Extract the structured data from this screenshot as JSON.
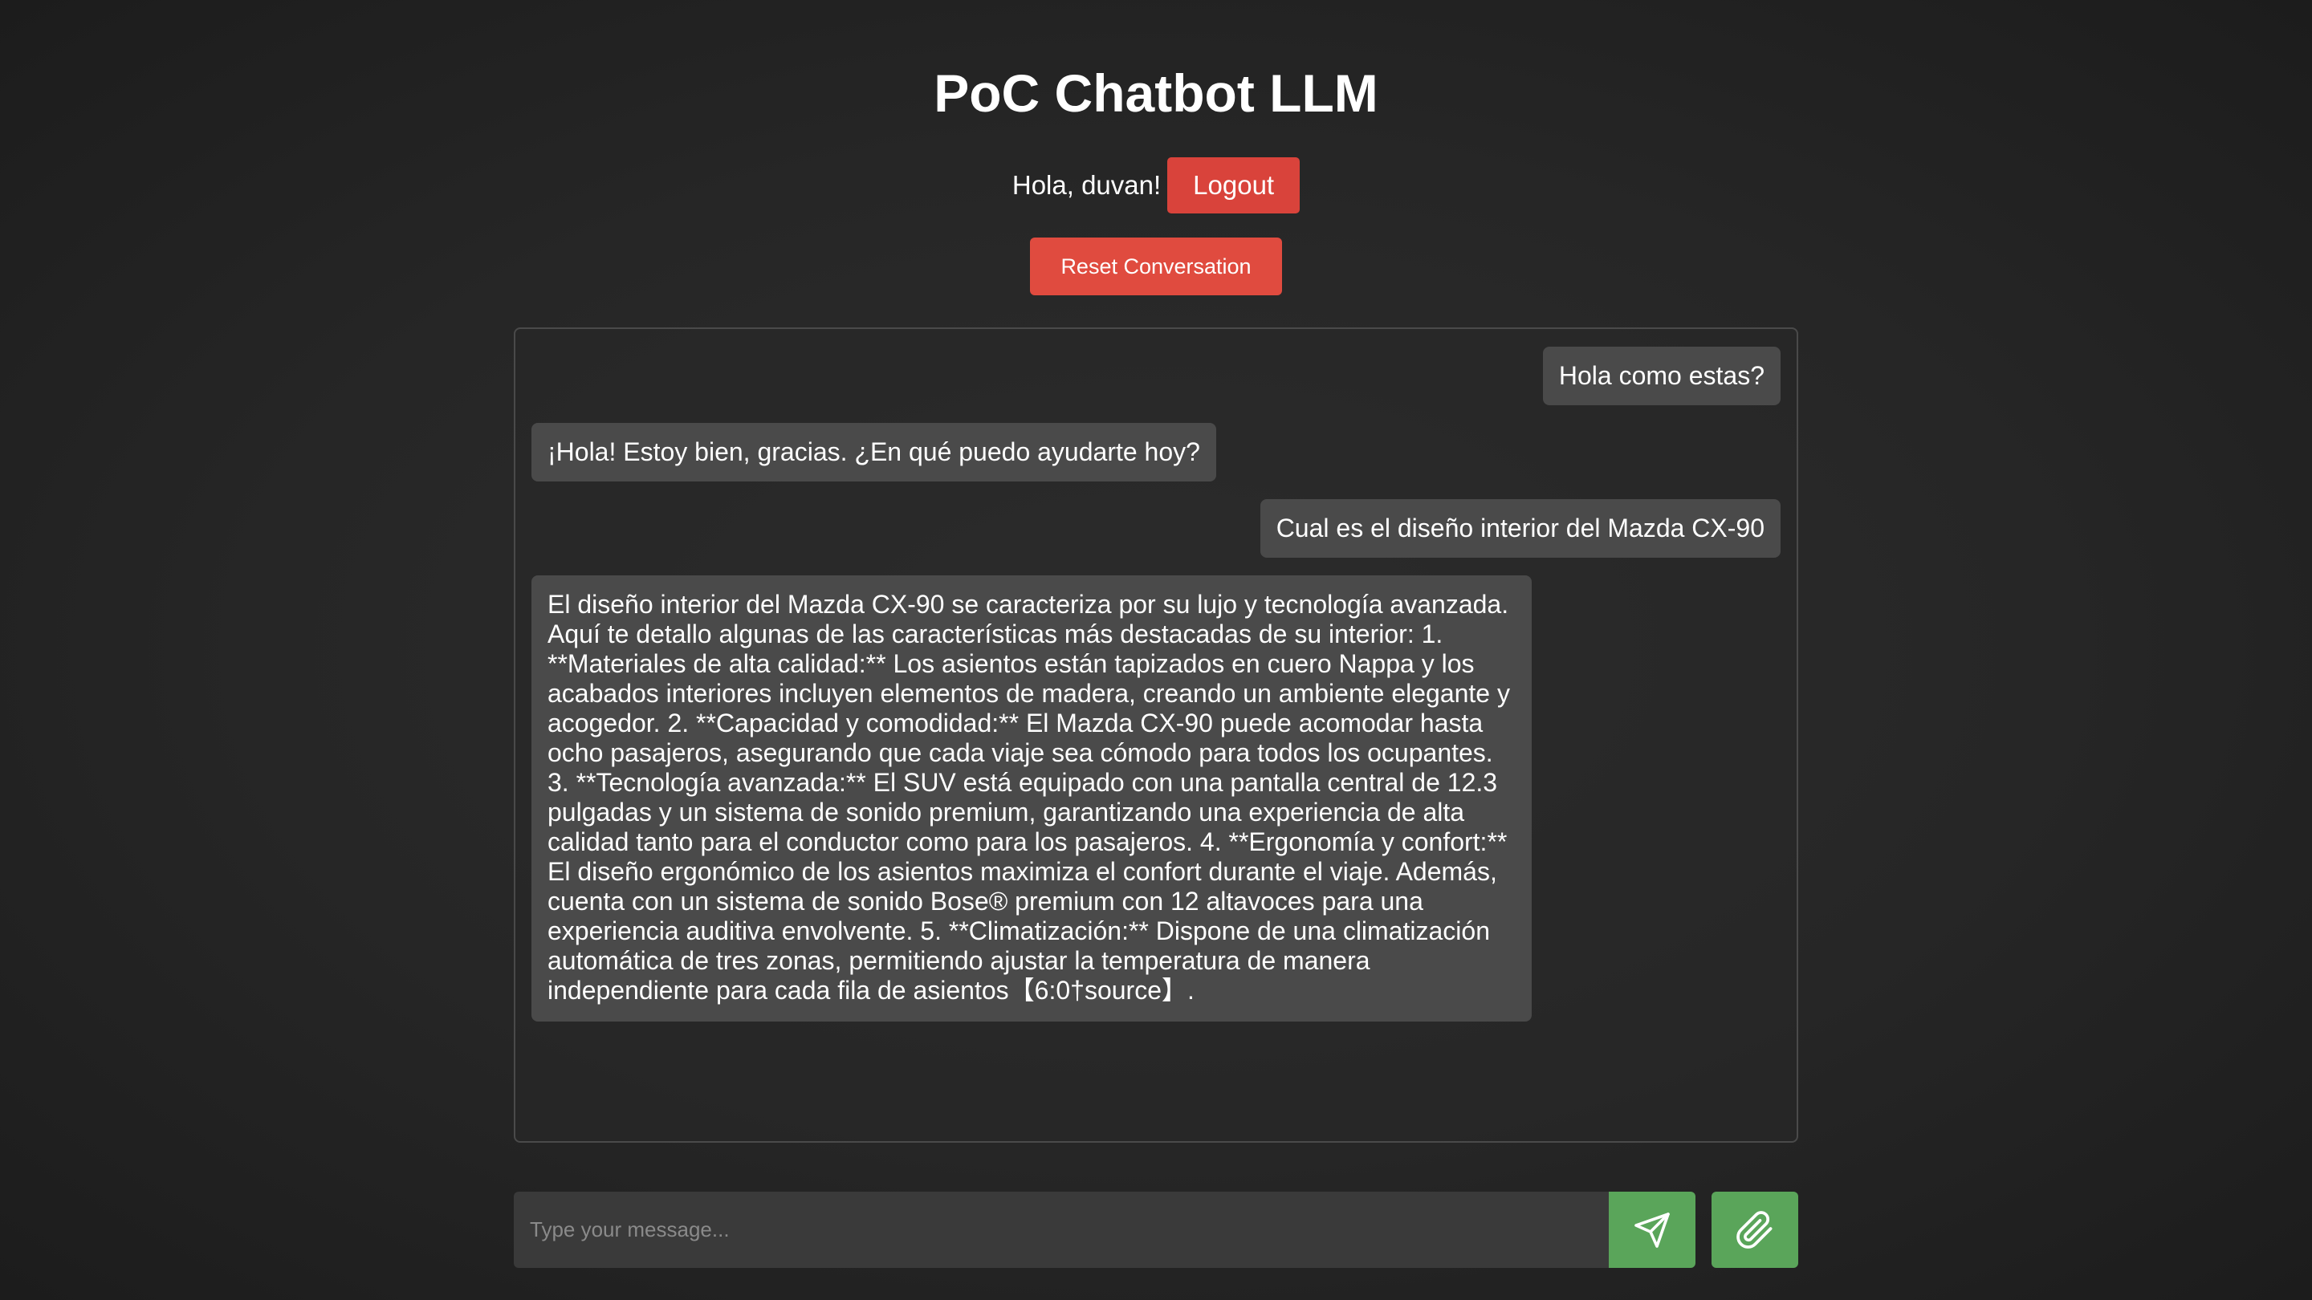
{
  "header": {
    "title": "PoC Chatbot LLM",
    "greeting": "Hola, duvan!",
    "logout_label": "Logout",
    "reset_label": "Reset Conversation"
  },
  "chat": {
    "messages": [
      {
        "role": "user",
        "text": "Hola como estas?"
      },
      {
        "role": "bot",
        "text": "¡Hola! Estoy bien, gracias. ¿En qué puedo ayudarte hoy?"
      },
      {
        "role": "user",
        "text": "Cual es el diseño interior del Mazda CX-90"
      },
      {
        "role": "bot",
        "text": "El diseño interior del Mazda CX-90 se caracteriza por su lujo y tecnología avanzada. Aquí te detallo algunas de las características más destacadas de su interior: 1. **Materiales de alta calidad:** Los asientos están tapizados en cuero Nappa y los acabados interiores incluyen elementos de madera, creando un ambiente elegante y acogedor. 2. **Capacidad y comodidad:** El Mazda CX-90 puede acomodar hasta ocho pasajeros, asegurando que cada viaje sea cómodo para todos los ocupantes. 3. **Tecnología avanzada:** El SUV está equipado con una pantalla central de 12.3 pulgadas y un sistema de sonido premium, garantizando una experiencia de alta calidad tanto para el conductor como para los pasajeros. 4. **Ergonomía y confort:** El diseño ergonómico de los asientos maximiza el confort durante el viaje. Además, cuenta con un sistema de sonido Bose® premium con 12 altavoces para una experiencia auditiva envolvente. 5. **Climatización:** Dispone de una climatización automática de tres zonas, permitiendo ajustar la temperatura de manera independiente para cada fila de asientos【6:0†source】."
      }
    ]
  },
  "composer": {
    "placeholder": "Type your message...",
    "send_icon": "paper-plane-icon",
    "attach_icon": "paperclip-icon"
  },
  "colors": {
    "background": "#262626",
    "logout": "#d9433b",
    "reset": "#e04b3f",
    "bubble": "#4a4a4a",
    "action_green": "#5aa55a"
  }
}
